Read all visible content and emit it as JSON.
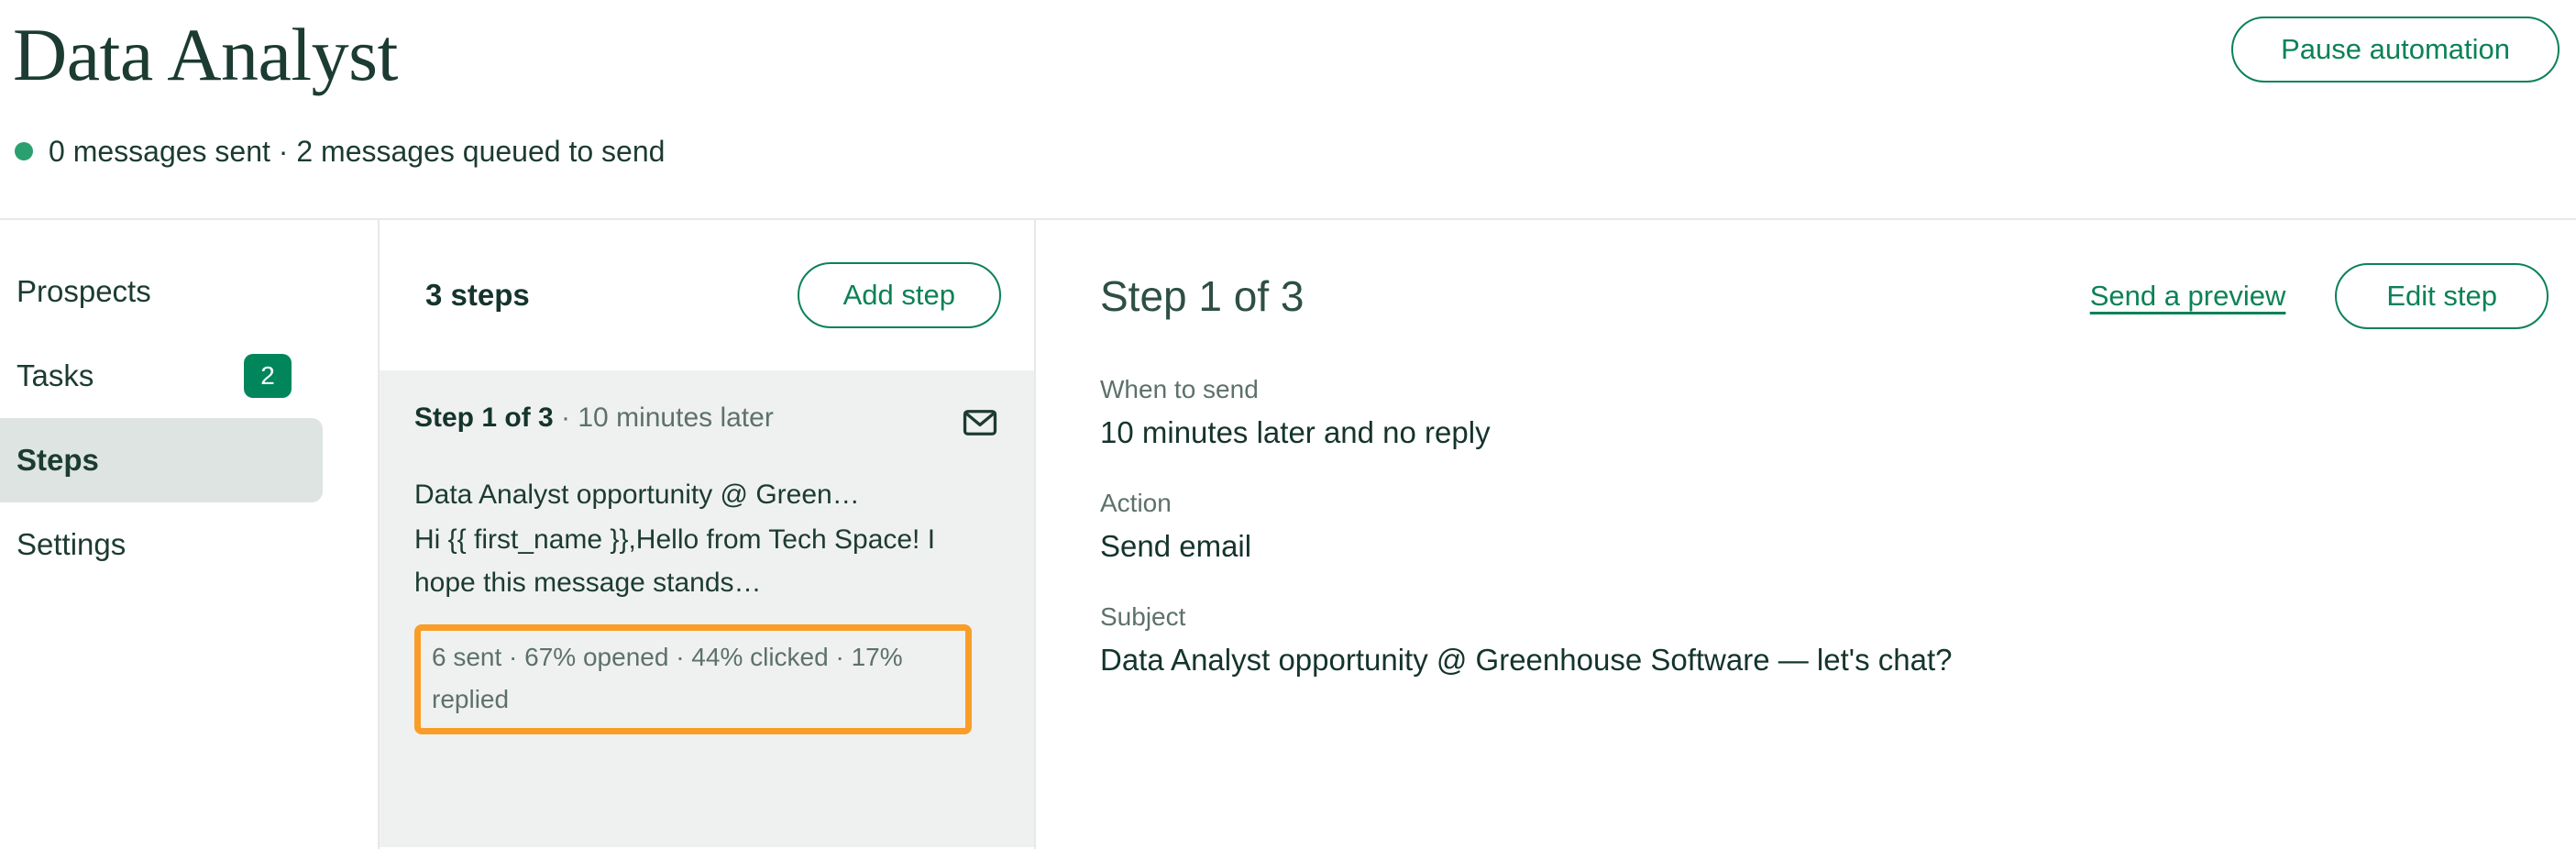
{
  "header": {
    "title": "Data Analyst",
    "status_dot_color": "#2aa06e",
    "status_text": "0 messages sent · 2 messages queued to send",
    "pause_button": "Pause automation"
  },
  "sidebar": {
    "items": [
      {
        "label": "Prospects",
        "badge": "",
        "active": false
      },
      {
        "label": "Tasks",
        "badge": "2",
        "active": false
      },
      {
        "label": "Steps",
        "badge": "",
        "active": true
      },
      {
        "label": "Settings",
        "badge": "",
        "active": false
      }
    ]
  },
  "steps_panel": {
    "count_label": "3 steps",
    "add_step_button": "Add step",
    "card": {
      "step_label": "Step 1 of 3",
      "separator": " · ",
      "timing": "10 minutes later",
      "icon": "mail-icon",
      "subject": "Data Analyst opportunity @ Green…",
      "preview": "Hi {{ first_name }},Hello from Tech Space! I hope this message stands…",
      "stats": "6 sent · 67% opened · 44% clicked · 17% replied",
      "stats_highlight_color": "#f99d28"
    }
  },
  "detail": {
    "title": "Step 1 of 3",
    "preview_link": "Send a preview",
    "edit_button": "Edit step",
    "fields": [
      {
        "label": "When to send",
        "value": "10 minutes later and no reply"
      },
      {
        "label": "Action",
        "value": "Send email"
      },
      {
        "label": "Subject",
        "value": "Data Analyst opportunity @ Greenhouse Software — let's chat?"
      }
    ]
  },
  "colors": {
    "brand_green": "#0b8256",
    "dark_green": "#1c3b32",
    "muted_green": "#5d7169",
    "panel_bg": "#eff1f0",
    "active_nav_bg": "#dde4e1",
    "divider": "#e6e9e8",
    "highlight_orange": "#f99d28",
    "badge_green": "#00865a"
  }
}
